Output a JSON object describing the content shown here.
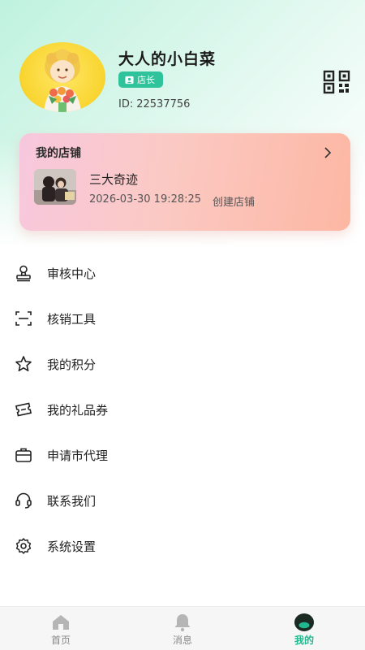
{
  "profile": {
    "username": "大人的小白菜",
    "role": "店长",
    "id_label": "ID:",
    "id_value": "22537756"
  },
  "shop_card": {
    "title": "我的店铺",
    "shop_name": "三大奇迹",
    "created_time": "2026-03-30 19:28:25",
    "created_label": "创建店铺"
  },
  "menu": {
    "items": [
      {
        "label": "审核中心",
        "icon": "audit-stamp-icon"
      },
      {
        "label": "核销工具",
        "icon": "scan-icon"
      },
      {
        "label": "我的积分",
        "icon": "star-icon"
      },
      {
        "label": "我的礼品券",
        "icon": "ticket-icon"
      },
      {
        "label": "申请市代理",
        "icon": "briefcase-icon"
      },
      {
        "label": "联系我们",
        "icon": "headset-icon"
      },
      {
        "label": "系统设置",
        "icon": "gear-icon"
      }
    ]
  },
  "tabbar": {
    "tabs": [
      {
        "label": "首页",
        "icon": "home-icon",
        "active": false
      },
      {
        "label": "消息",
        "icon": "bell-icon",
        "active": false
      },
      {
        "label": "我的",
        "icon": "user-icon",
        "active": true
      }
    ]
  },
  "colors": {
    "accent": "#2ec39b",
    "active_tab": "#22b88f",
    "card_start": "#f7c8de",
    "card_end": "#fdb7a3"
  }
}
